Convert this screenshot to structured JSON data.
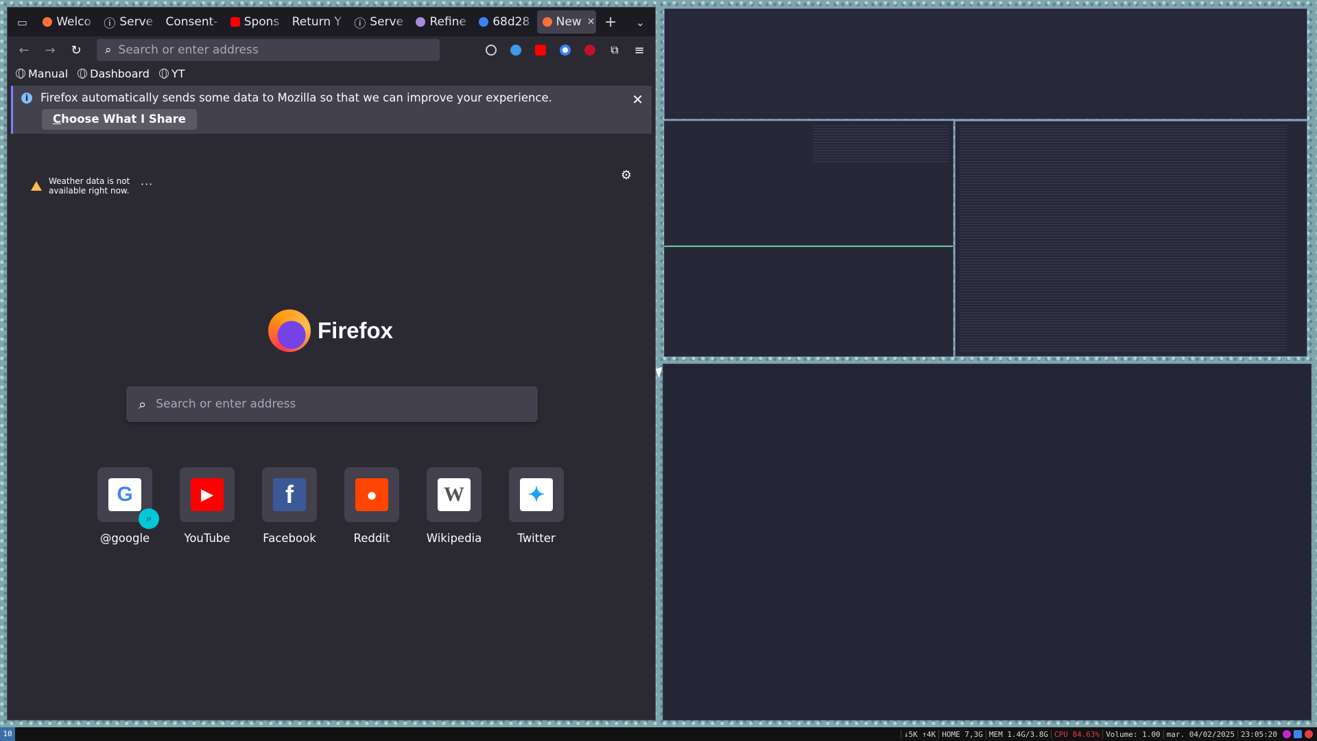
{
  "tabs": [
    {
      "label": "Welco",
      "favicon_color": "#ff7139"
    },
    {
      "label": "Serve",
      "favicon_color": "#9e9ea8"
    },
    {
      "label": "Consent-",
      "favicon_color": ""
    },
    {
      "label": "Spons",
      "favicon_color": "#ff0000"
    },
    {
      "label": "Return Y",
      "favicon_color": ""
    },
    {
      "label": "Serve",
      "favicon_color": "#9e9ea8"
    },
    {
      "label": "Refine",
      "favicon_color": "#a98bd9"
    },
    {
      "label": "68d28",
      "favicon_color": "#3b82f6"
    },
    {
      "label": "New",
      "favicon_color": "#ff7139"
    }
  ],
  "toolbar": {
    "url_placeholder": "Search or enter address"
  },
  "bookmarks": [
    "Manual",
    "Dashboard",
    "YT"
  ],
  "notification": {
    "message": "Firefox automatically sends some data to Mozilla so that we can improve your experience.",
    "button_first": "C",
    "button_rest": "hoose What I Share"
  },
  "weather": {
    "line1": "Weather data is not",
    "line2": "available right now."
  },
  "brand": "Firefox",
  "newtab_search_placeholder": "Search or enter address",
  "shortcuts": [
    {
      "label": "@google",
      "icon": "G"
    },
    {
      "label": "YouTube",
      "icon": "▶"
    },
    {
      "label": "Facebook",
      "icon": "f"
    },
    {
      "label": "Reddit",
      "icon": "●"
    },
    {
      "label": "Wikipedia",
      "icon": "W"
    },
    {
      "label": "Twitter",
      "icon": "✦"
    }
  ],
  "statusbar": {
    "workspace": "10",
    "net": "↓5K ↑4K",
    "home": "HOME 7,3G",
    "mem": "MEM 1.4G/3.8G",
    "cpu": "CPU 84.63%",
    "volume": "Volume: 1.00",
    "date": "mar. 04/02/2025",
    "time": "23:05:20"
  },
  "colors": {
    "accent": "#8080ff",
    "info": "#80bfff",
    "warning": "#ffbd4f",
    "cpu_alert": "#e04040"
  }
}
